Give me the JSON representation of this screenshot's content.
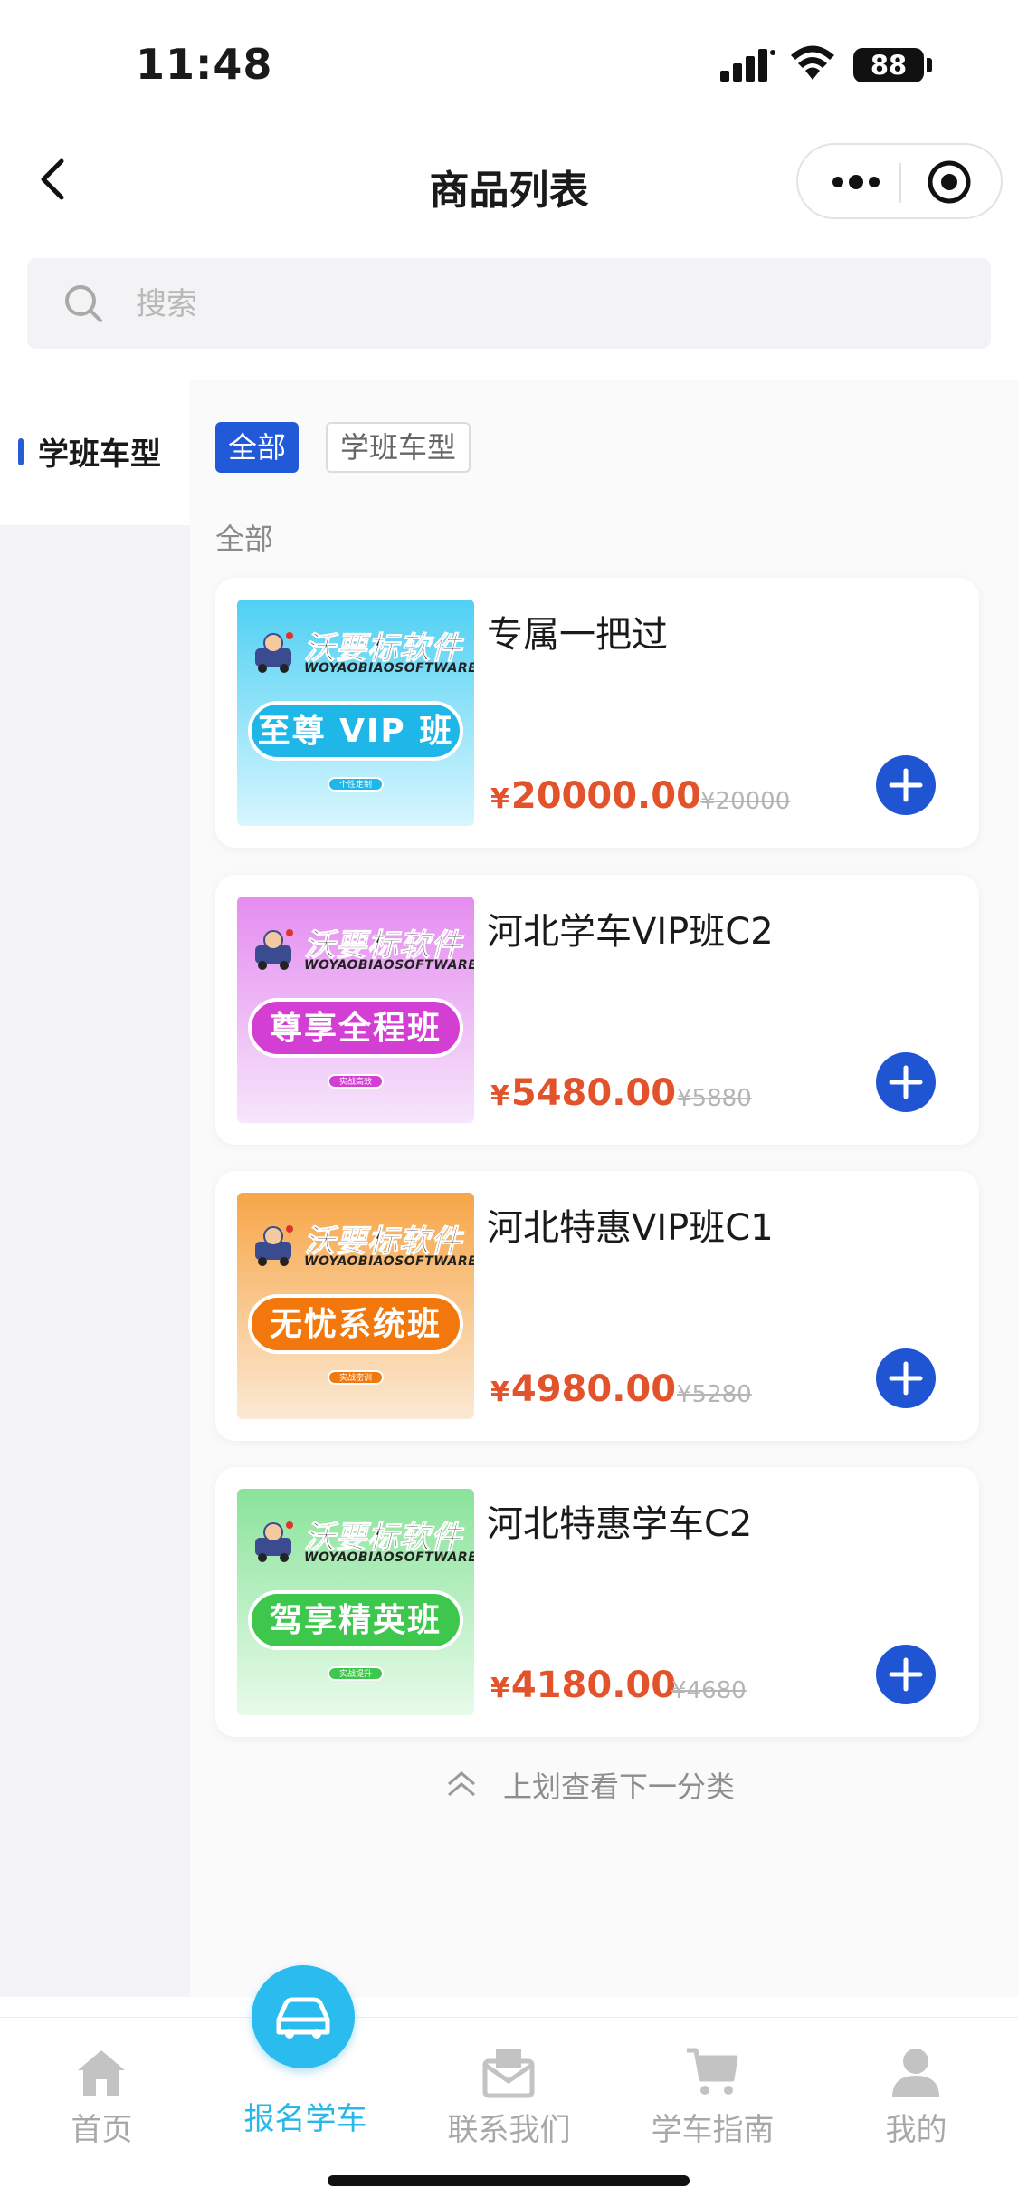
{
  "status": {
    "time": "11:48",
    "battery": "88"
  },
  "nav": {
    "title": "商品列表"
  },
  "search": {
    "placeholder": "搜索"
  },
  "sidebar": {
    "items": [
      {
        "label": "学班车型",
        "active": true
      }
    ]
  },
  "filters": [
    {
      "label": "全部",
      "active": true
    },
    {
      "label": "学班车型",
      "active": false
    }
  ],
  "section_label": "全部",
  "brand": {
    "name": "沃要标软件",
    "sub": "WOYAOBIAOSOFTWARE"
  },
  "products": [
    {
      "name": "专属一把过",
      "price": "20000.00",
      "old_price": "¥20000",
      "badge": "至尊 VIP 班",
      "badge_color": "#1fb6e8",
      "bg_from": "#4fd0f3",
      "bg_to": "#d8f6fe",
      "mini": "个性定制"
    },
    {
      "name": "河北学车VIP班C2",
      "price": "5480.00",
      "old_price": "¥5880",
      "badge": "尊享全程班",
      "badge_color": "#d23fd2",
      "bg_from": "#e58cf0",
      "bg_to": "#f6e6fb",
      "mini": "实战高效"
    },
    {
      "name": "河北特惠VIP班C1",
      "price": "4980.00",
      "old_price": "¥5280",
      "badge": "无忧系统班",
      "badge_color": "#f2780d",
      "bg_from": "#f7a648",
      "bg_to": "#fbe9d4",
      "mini": "实战密训"
    },
    {
      "name": "河北特惠学车C2",
      "price": "4180.00",
      "old_price": "¥4680",
      "badge": "驾享精英班",
      "badge_color": "#3dc74c",
      "bg_from": "#8ae39a",
      "bg_to": "#e8fbea",
      "mini": "实战提升"
    }
  ],
  "currency": "¥",
  "hint": "上划查看下一分类",
  "tabs": [
    {
      "label": "首页",
      "icon": "home-icon"
    },
    {
      "label": "报名学车",
      "icon": "car-icon",
      "active": true
    },
    {
      "label": "联系我们",
      "icon": "mail-icon"
    },
    {
      "label": "学车指南",
      "icon": "cart-icon"
    },
    {
      "label": "我的",
      "icon": "user-icon"
    }
  ],
  "colors": {
    "accent": "#2159d8",
    "price": "#e2522b",
    "tab_active": "#27b7e8"
  }
}
